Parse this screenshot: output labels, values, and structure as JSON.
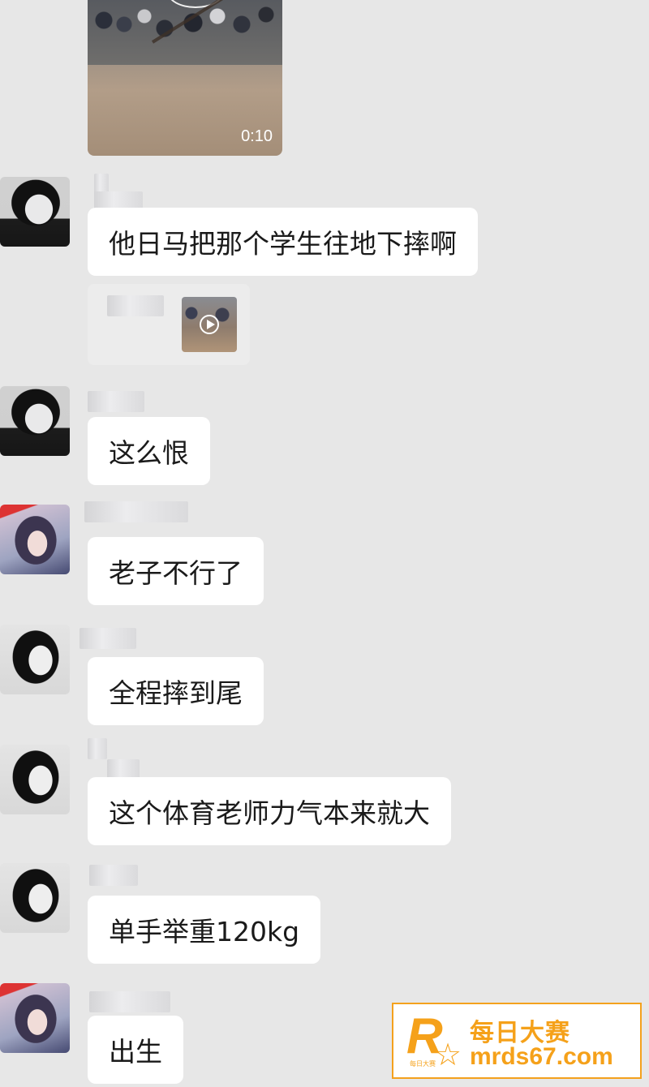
{
  "video": {
    "duration": "0:10"
  },
  "messages": [
    {
      "avatar": "boy-avatar",
      "text": "他日马把那个学生往地下摔啊"
    },
    {
      "avatar": "boy-avatar",
      "text": "这么恨"
    },
    {
      "avatar": "girl-avatar",
      "text": "老子不行了"
    },
    {
      "avatar": "bw-girl-avatar",
      "text": "全程摔到尾"
    },
    {
      "avatar": "bw-girl-avatar",
      "text": "这个体育老师力气本来就大"
    },
    {
      "avatar": "bw-girl-avatar",
      "text": "单手举重120kg"
    },
    {
      "avatar": "girl-avatar",
      "text": "出生"
    }
  ],
  "watermark": {
    "logo_letter": "R",
    "logo_small": "每日大赛",
    "title": "每日大赛",
    "url": "mrds67.com",
    "accent_color": "#f5a11a"
  }
}
